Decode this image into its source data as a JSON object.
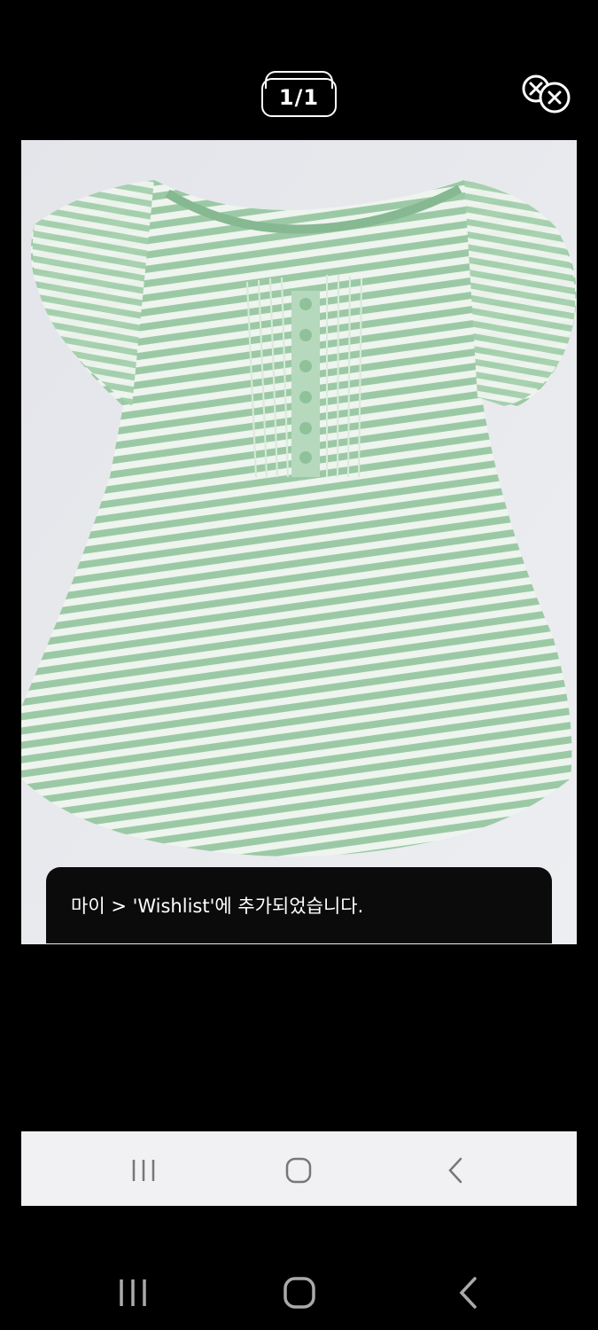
{
  "viewer": {
    "counter": "1/1"
  },
  "toast": {
    "message": "마이 > 'Wishlist'에 추가되었습니다."
  },
  "icons": {
    "close": "close-icon",
    "recents": "recents-icon",
    "home": "home-icon",
    "back": "back-icon"
  },
  "colors": {
    "background": "#000000",
    "toast_bg": "#0b0b0b",
    "inner_nav_bg": "#f1f1f4",
    "shirt_green": "#9cc9a5",
    "shirt_white": "#eef4ee",
    "cloth_bg": "#e7e8ec"
  }
}
